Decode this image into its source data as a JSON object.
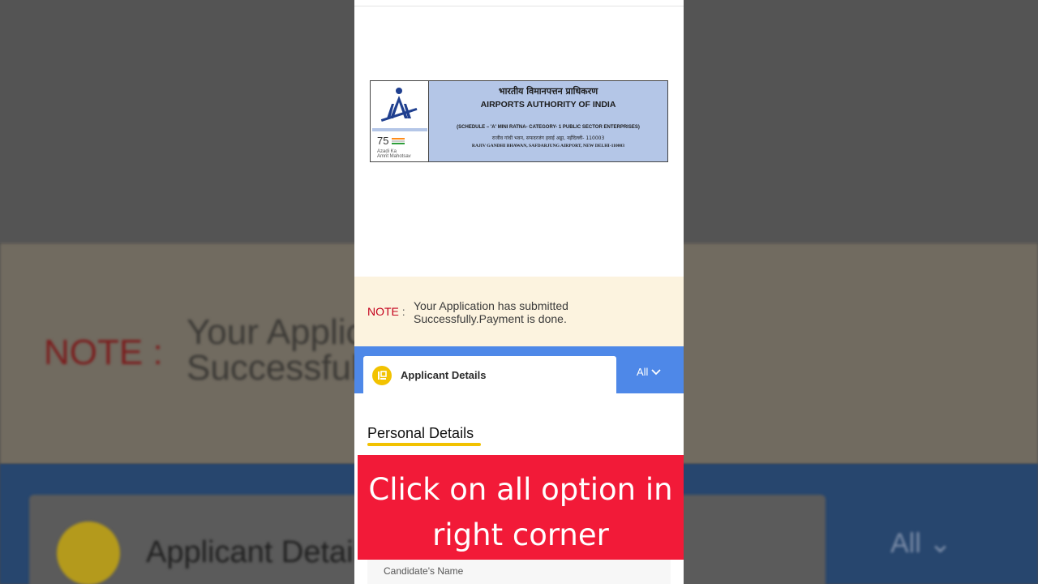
{
  "header": {
    "hindi_title": "भारतीय विमानपत्तन प्राधिकरण",
    "english_title": "AIRPORTS AUTHORITY OF INDIA",
    "schedule": "(SCHEDULE – 'A' MINI RATNA- CATEGORY- 1 PUBLIC SECTOR ENTERPRISES)",
    "address_hindi": "राजीव गांधी भवन, सफदरजंग हवाई अड्डा, नईदिल्ली- 110003",
    "address_english": "RAJIV GANDHI BHAWAN, SAFDARJUNG AIRPORT, NEW DELHI-110003",
    "logo_text": "Azadi Ka Amrit Mahotsav"
  },
  "note": {
    "label": "NOTE",
    "colon": ":",
    "message": "Your Application has submitted Successfully.Payment is done."
  },
  "tabs": {
    "applicant_label": "Applicant Details",
    "all_label": "All"
  },
  "section": {
    "title": "Personal Details"
  },
  "overlay": {
    "banner_text": "Click on all option in right corner"
  },
  "fields": {
    "candidate_name_label": "Candidate's Name"
  },
  "colors": {
    "accent_blue": "#4e88e8",
    "accent_yellow": "#f2c200",
    "banner_red": "#f21a38",
    "note_red": "#c4001c",
    "header_blue": "#b4c6e7"
  }
}
